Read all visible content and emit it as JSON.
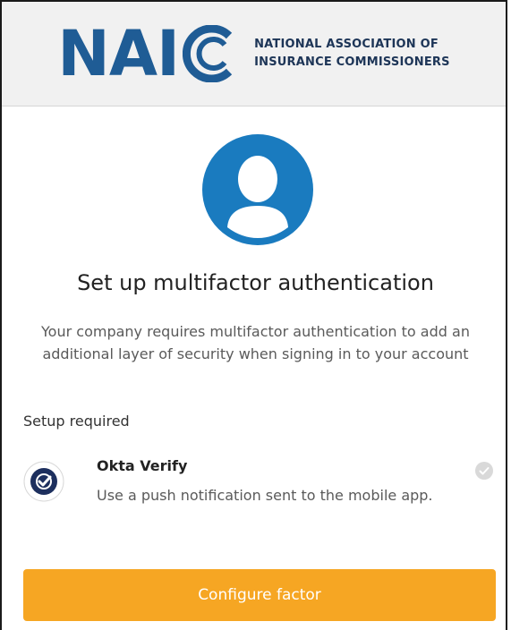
{
  "header": {
    "logo_word": "NAI",
    "logo_line1": "NATIONAL ASSOCIATION OF",
    "logo_line2": "INSURANCE COMMISSIONERS",
    "logo_color": "#1f5c95"
  },
  "main": {
    "avatar_icon": "user-avatar-icon",
    "title": "Set up multifactor authentication",
    "description": "Your company requires multifactor authentication to add an additional layer of security when signing in to your account",
    "setup_label": "Setup required"
  },
  "factor": {
    "name": "Okta Verify",
    "description": "Use a push notification sent to the mobile app.",
    "icon": "okta-verify-icon",
    "status_icon": "check-circle-icon"
  },
  "actions": {
    "configure_label": "Configure factor",
    "button_color": "#f6a623"
  }
}
